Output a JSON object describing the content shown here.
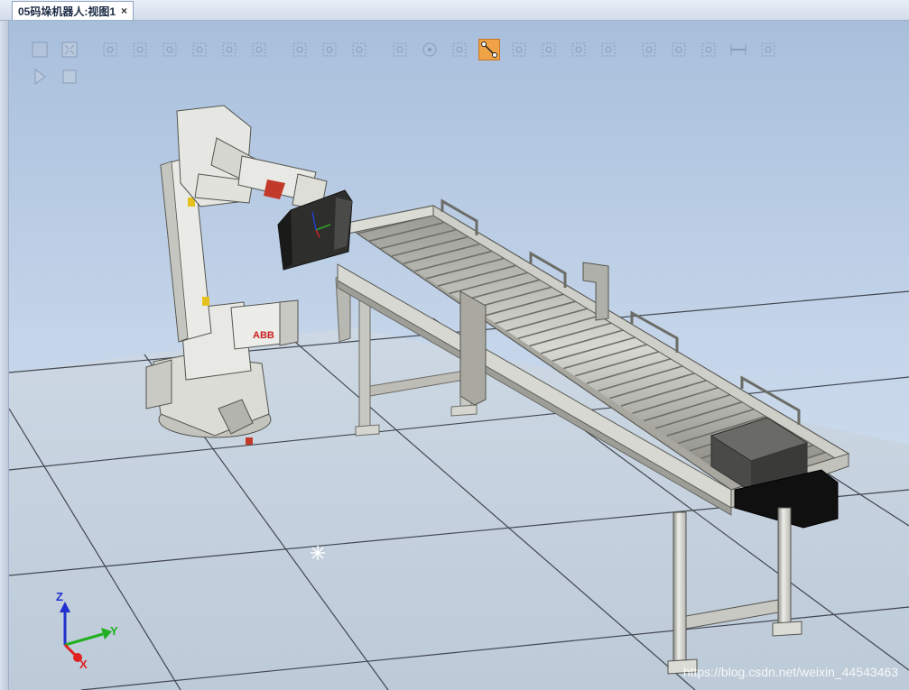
{
  "window": {
    "tab_title": "05码垛机器人:视图1",
    "close_glyph": "×"
  },
  "toolbar": {
    "row1_icons": [
      "view-all-icon",
      "fit-view-icon",
      "select-curve-icon",
      "select-surface-icon",
      "select-body-icon",
      "select-part-icon",
      "select-group-icon",
      "select-mechanism-icon",
      "select-target-icon",
      "select-frame-icon",
      "select-path-icon",
      "snap-object-icon",
      "snap-center-icon",
      "snap-middle-icon",
      "snap-edge-icon",
      "snap-intersection-icon",
      "snap-local-origin-icon",
      "snap-grid-icon",
      "snap-ux-icon",
      "measure-point-icon",
      "measure-angle-icon",
      "measure-diameter-icon",
      "measure-distance-icon",
      "measure-shortest-icon"
    ],
    "row2_icons": [
      "play-icon",
      "stop-icon"
    ],
    "active_icon": "snap-edge-icon"
  },
  "axes": {
    "z_label": "Z",
    "y_label": "Y",
    "x_label": "X",
    "x_color": "#e02020",
    "y_color": "#20b020",
    "z_color": "#2030d0"
  },
  "scene": {
    "robot_brand": "ABB",
    "floor_color": "#c6d2de",
    "robot_color": "#e6e6e2"
  },
  "watermark": "https://blog.csdn.net/weixin_44543463"
}
